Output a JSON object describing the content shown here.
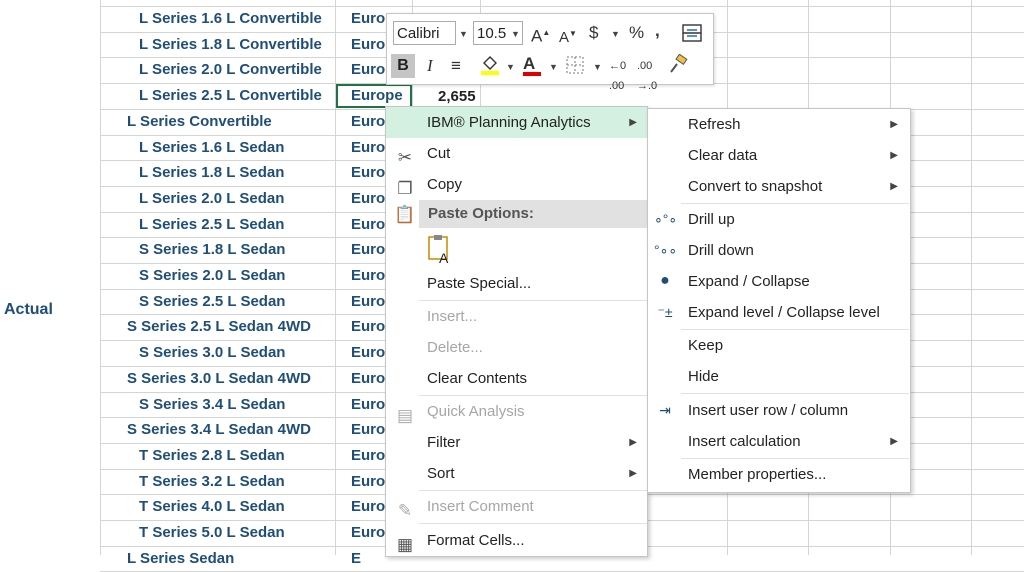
{
  "spreadsheet": {
    "group_label": "Actual",
    "rows": [
      {
        "model": "L Series 1.6 L Convertible",
        "region": "Euro"
      },
      {
        "model": "L Series 1.8 L Convertible",
        "region": "Euro"
      },
      {
        "model": "L Series 2.0 L Convertible",
        "region": "Euro"
      },
      {
        "model": "L Series 2.5 L Convertible",
        "region": "Europe",
        "value": "2,655"
      },
      {
        "model": "L Series Convertible",
        "region": "Euro"
      },
      {
        "model": "L Series 1.6 L Sedan",
        "region": "Euro"
      },
      {
        "model": "L Series 1.8 L Sedan",
        "region": "Euro"
      },
      {
        "model": "L Series 2.0 L Sedan",
        "region": "Euro"
      },
      {
        "model": "L Series 2.5 L Sedan",
        "region": "Euro"
      },
      {
        "model": "S Series 1.8 L Sedan",
        "region": "Euro"
      },
      {
        "model": "S Series 2.0 L Sedan",
        "region": "Euro"
      },
      {
        "model": "S Series 2.5 L Sedan",
        "region": "Euro"
      },
      {
        "model": "S Series 2.5 L Sedan 4WD",
        "region": "Euro"
      },
      {
        "model": "S Series 3.0 L Sedan",
        "region": "Euro"
      },
      {
        "model": "S Series 3.0 L Sedan 4WD",
        "region": "Euro"
      },
      {
        "model": "S Series 3.4 L Sedan",
        "region": "Euro"
      },
      {
        "model": "S Series 3.4 L Sedan 4WD",
        "region": "Euro"
      },
      {
        "model": "T Series 2.8 L Sedan",
        "region": "Euro"
      },
      {
        "model": "T Series 3.2 L Sedan",
        "region": "Euro"
      },
      {
        "model": "T Series 4.0 L Sedan",
        "region": "Euro"
      },
      {
        "model": "T Series 5.0 L Sedan",
        "region": "Euro"
      },
      {
        "model": "L Series Sedan",
        "region": "E"
      }
    ]
  },
  "mini_toolbar": {
    "font_name": "Calibri",
    "font_size": "10.5",
    "bold_label": "B",
    "italic_label": "I",
    "currency_label": "$",
    "percent_label": "%",
    "comma_label": ","
  },
  "context_menu": {
    "items": [
      {
        "label": "IBM® Planning Analytics",
        "icon": "none",
        "has_submenu": true
      },
      {
        "label": "Cut",
        "icon": "scissors-icon"
      },
      {
        "label": "Copy",
        "icon": "copy-icon"
      },
      {
        "label": "Paste Options:",
        "icon": "clipboard-icon",
        "header": true
      },
      {
        "label": "Paste Special...",
        "icon": "none"
      },
      {
        "label": "Insert...",
        "disabled": true
      },
      {
        "label": "Delete...",
        "disabled": true
      },
      {
        "label": "Clear Contents"
      },
      {
        "label": "Quick Analysis",
        "icon": "quick-analysis-icon",
        "disabled": true
      },
      {
        "label": "Filter",
        "has_submenu": true
      },
      {
        "label": "Sort",
        "has_submenu": true
      },
      {
        "label": "Insert Comment",
        "icon": "comment-icon",
        "disabled": true
      },
      {
        "label": "Format Cells...",
        "icon": "format-cells-icon"
      }
    ]
  },
  "submenu": {
    "items": [
      {
        "label": "Refresh",
        "has_submenu": true
      },
      {
        "label": "Clear data",
        "has_submenu": true
      },
      {
        "label": "Convert to snapshot",
        "has_submenu": true
      },
      {
        "label": "Drill up",
        "icon": "drill-up-icon"
      },
      {
        "label": "Drill down",
        "icon": "drill-down-icon"
      },
      {
        "label": "Expand / Collapse",
        "icon": "expand-collapse-icon"
      },
      {
        "label": "Expand level / Collapse level",
        "icon": "expand-level-icon"
      },
      {
        "label": "Keep"
      },
      {
        "label": "Hide"
      },
      {
        "label": "Insert user row / column",
        "icon": "insert-row-icon"
      },
      {
        "label": "Insert calculation",
        "has_submenu": true
      },
      {
        "label": "Member properties..."
      }
    ]
  },
  "colors": {
    "cell_text": "#1f4e79",
    "selection_border": "#217346",
    "highlight": "#d3f0e0"
  }
}
